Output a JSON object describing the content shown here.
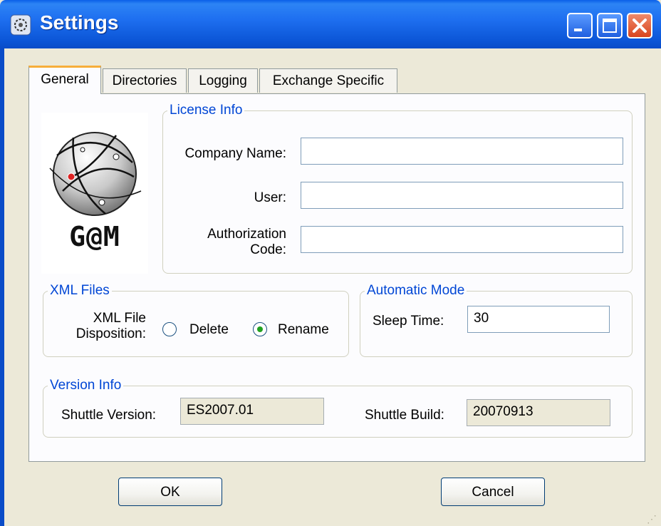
{
  "window": {
    "title": "Settings",
    "app_icon": "settings-app-icon"
  },
  "tabs": [
    {
      "label": "General",
      "active": true
    },
    {
      "label": "Directories",
      "active": false
    },
    {
      "label": "Logging",
      "active": false
    },
    {
      "label": "Exchange Specific",
      "active": false
    }
  ],
  "logo": {
    "text": "G@M"
  },
  "license_info": {
    "legend": "License Info",
    "company_name_label": "Company Name:",
    "company_name_value": "",
    "user_label": "User:",
    "user_value": "",
    "auth_label_line1": "Authorization",
    "auth_label_line2": "Code:",
    "auth_value": ""
  },
  "xml_files": {
    "legend": "XML Files",
    "disposition_label_line1": "XML File",
    "disposition_label_line2": "Disposition:",
    "options": [
      {
        "label": "Delete",
        "checked": false
      },
      {
        "label": "Rename",
        "checked": true
      }
    ]
  },
  "automatic_mode": {
    "legend": "Automatic Mode",
    "sleep_time_label": "Sleep Time:",
    "sleep_time_value": "30"
  },
  "version_info": {
    "legend": "Version Info",
    "shuttle_version_label": "Shuttle Version:",
    "shuttle_version_value": "ES2007.01",
    "shuttle_build_label": "Shuttle Build:",
    "shuttle_build_value": "20070913"
  },
  "buttons": {
    "ok": "OK",
    "cancel": "Cancel"
  },
  "colors": {
    "titlebar": "#0a5fe8",
    "group_legend": "#0046d5",
    "tab_accent": "#f7ae3a",
    "radio_dot": "#21a121"
  }
}
